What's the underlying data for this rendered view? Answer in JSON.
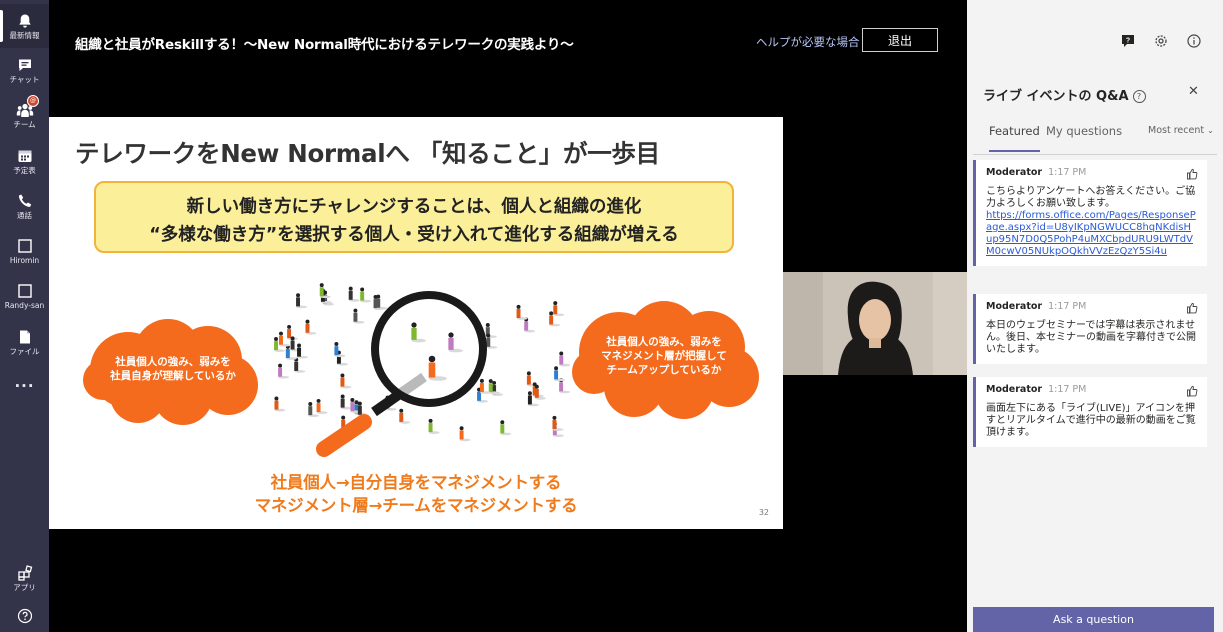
{
  "rail": {
    "items": [
      {
        "label": "最新情報",
        "icon": "bell-icon"
      },
      {
        "label": "チャット",
        "icon": "chat-icon"
      },
      {
        "label": "チーム",
        "icon": "teams-icon",
        "badge": "@"
      },
      {
        "label": "予定表",
        "icon": "calendar-icon"
      },
      {
        "label": "通話",
        "icon": "phone-icon"
      },
      {
        "label": "Hiromin",
        "icon": "app-icon"
      },
      {
        "label": "Randy-san",
        "icon": "app-icon"
      },
      {
        "label": "ファイル",
        "icon": "file-icon"
      }
    ],
    "more_label": "...",
    "apps_label": "アプリ",
    "help_label": "ヘルプ"
  },
  "header": {
    "title": "組織と社員がReskillする！〜New Normal時代におけるテレワークの実践より〜",
    "help_link": "ヘルプが必要な場合",
    "leave_button": "退出"
  },
  "slide": {
    "title": "テレワークをNew Normalへ 「知ること」が一歩目",
    "box_line1": "新しい働き方にチャレンジすることは、個人と組織の進化",
    "box_line2": "“多様な働き方”を選択する個人・受け入れて進化する組織が増える",
    "cloud_left": [
      "社員個人の強み、弱みを",
      "社員自身が理解しているか"
    ],
    "cloud_right": [
      "社員個人の強み、弱みを",
      "マネジメント層が把握して",
      "チームアップしているか"
    ],
    "bottom_line1": "社員個人→自分自身をマネジメントする",
    "bottom_line2": "マネジメント層→チームをマネジメントする",
    "page_number": "32"
  },
  "panel": {
    "title": "ライブ イベントの Q&A",
    "tabs": [
      "Featured",
      "My questions"
    ],
    "sort_label": "Most recent",
    "cards": [
      {
        "author": "Moderator",
        "time": "1:17 PM",
        "text": "こちらよりアンケートへお答えください。ご協力よろしくお願い致します。",
        "link": "https://forms.office.com/Pages/ResponsePage.aspx?id=U8yIKpNGWUCC8hqNKdisHup95N7D0Q5PohP4uMXCbpdURU9LWTdVM0cwV05NUkpOQkhVVzEzQzY5Si4u"
      },
      {
        "author": "Moderator",
        "time": "1:17 PM",
        "text": "本日のウェブセミナーでは字幕は表示されません。後日、本セミナーの動画を字幕付きで公開いたします。"
      },
      {
        "author": "Moderator",
        "time": "1:17 PM",
        "text": "画面左下にある「ライブ(LIVE)」アイコンを押すとリアルタイムで進行中の最新の動画をご覧頂けます。"
      }
    ],
    "ask_button": "Ask a question"
  },
  "colors": {
    "rail_bg": "#33344a",
    "accent": "#6264a7",
    "slide_orange": "#f07b1c",
    "yellow_box": "#fbef9a"
  }
}
